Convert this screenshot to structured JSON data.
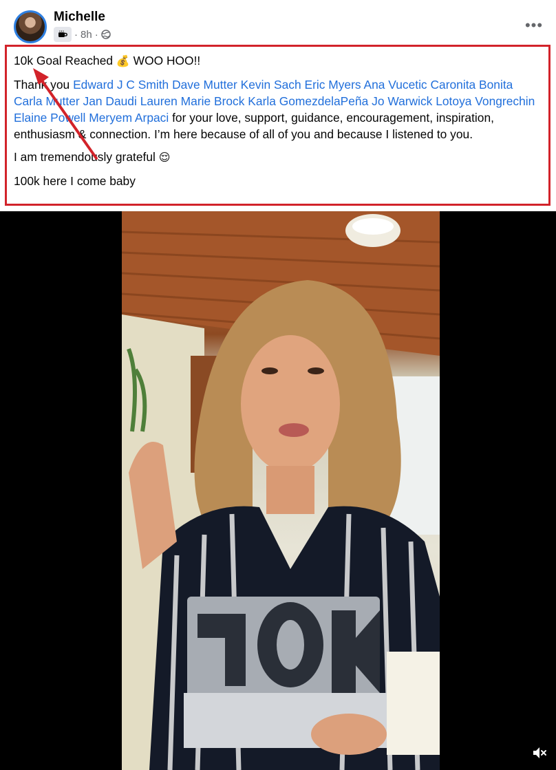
{
  "post": {
    "author": "Michelle",
    "time": "8h",
    "separator": "·",
    "badge_icon": "coffee-cup-icon",
    "audience_icon": "globe-icon",
    "more_label": "•••"
  },
  "content": {
    "line1_text": "10k Goal Reached",
    "line1_emoji": "💰",
    "line1_suffix": "WOO HOO!!",
    "thanks_prefix": "Thank you",
    "mentions": [
      "Edward J C Smith",
      "Dave Mutter",
      "Kevin Sach",
      "Eric Myers",
      "Ana Vucetic Caronita Bonita",
      "Carla Mutter",
      "Jan Daudi",
      "Lauren Marie Brock",
      "Karla GomezdelaPeña",
      "Jo Warwick",
      "Lotoya Vongrechin",
      "Elaine Powell",
      "Meryem Arpaci"
    ],
    "thanks_suffix": "for your love, support, guidance, encouragement, inspiration, enthusiasm & connection. I’m here because of all of you and because I listened to you.",
    "grateful_text": "I am tremendously grateful",
    "grateful_emoji": "😌",
    "closing_text": "100k here I come baby"
  },
  "colors": {
    "annotation_red": "#d2232a",
    "mention_blue": "#216fdb",
    "meta_gray": "#65676b"
  },
  "video": {
    "mute_icon": "speaker-muted-icon"
  }
}
